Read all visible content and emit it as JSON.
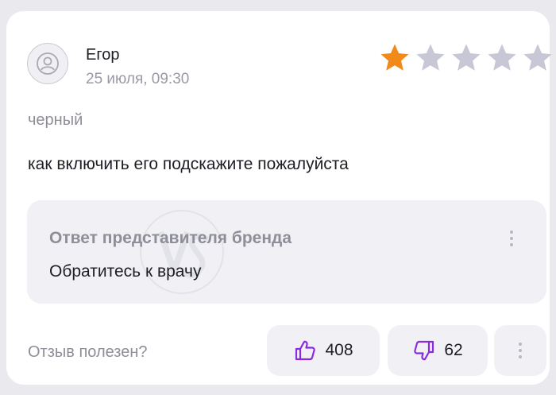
{
  "review": {
    "author": "Егор",
    "date": "25 июля, 09:30",
    "rating": 1,
    "rating_max": 5,
    "variant": "черный",
    "text": "как включить его подскажите пожалуйста"
  },
  "brand_reply": {
    "title": "Ответ представителя бренда",
    "text": "Обратитесь к врачу"
  },
  "feedback": {
    "helpful_label": "Отзыв полезен?",
    "likes": "408",
    "dislikes": "62"
  },
  "colors": {
    "star_filled": "#f28a1a",
    "star_empty": "#c7c7d6",
    "accent": "#8a2be2"
  },
  "icons": [
    "user-icon",
    "star-icon",
    "thumbs-up-icon",
    "thumbs-down-icon",
    "more-vertical-icon"
  ]
}
